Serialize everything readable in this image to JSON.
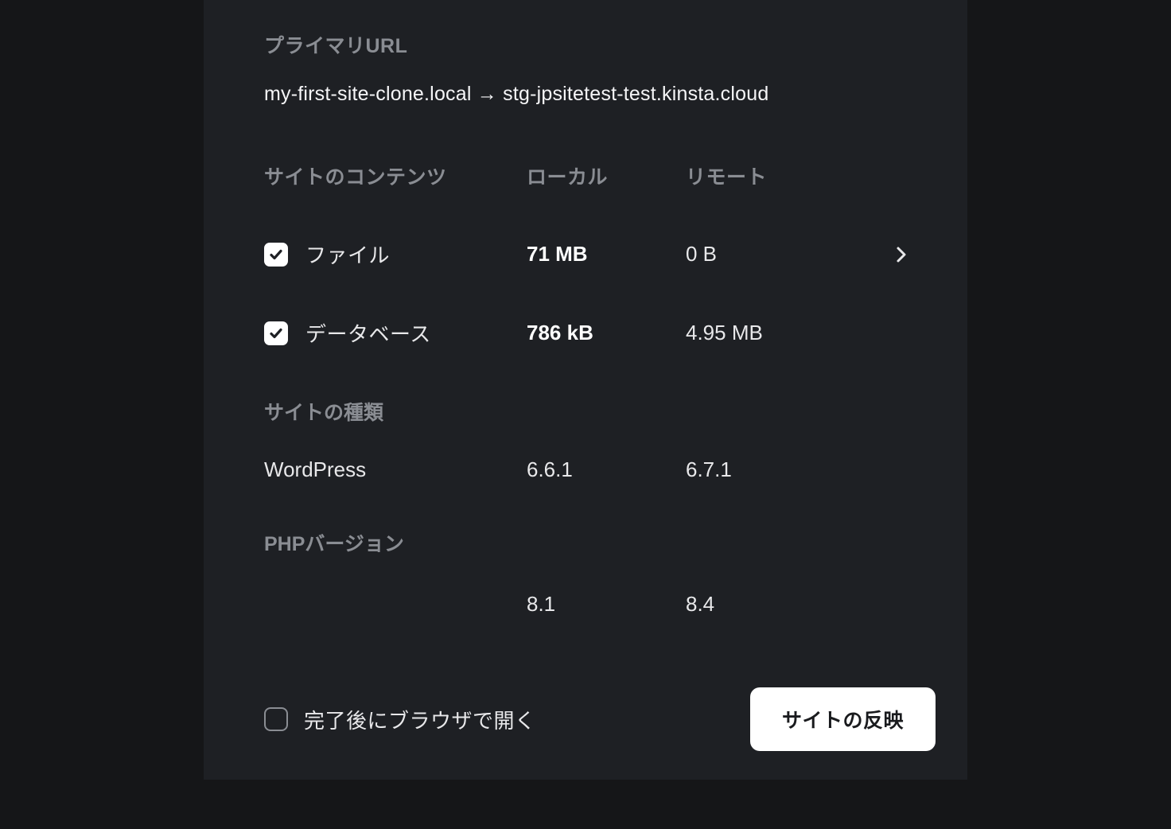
{
  "primary_url": {
    "label": "プライマリURL",
    "local": "my-first-site-clone.local",
    "arrow": "→",
    "remote": "stg-jpsitetest-test.kinsta.cloud"
  },
  "headers": {
    "content": "サイトのコンテンツ",
    "local": "ローカル",
    "remote": "リモート"
  },
  "rows": {
    "files": {
      "label": "ファイル",
      "local": "71 MB",
      "remote": "0 B",
      "checked": true,
      "expandable": true
    },
    "database": {
      "label": "データベース",
      "local": "786 kB",
      "remote": "4.95 MB",
      "checked": true,
      "expandable": false
    }
  },
  "site_type": {
    "label": "サイトの種類",
    "name": "WordPress",
    "local": "6.6.1",
    "remote": "6.7.1"
  },
  "php": {
    "label": "PHPバージョン",
    "local": "8.1",
    "remote": "8.4"
  },
  "footer": {
    "open_browser_label": "完了後にブラウザで開く",
    "open_browser_checked": false,
    "push_button": "サイトの反映"
  }
}
